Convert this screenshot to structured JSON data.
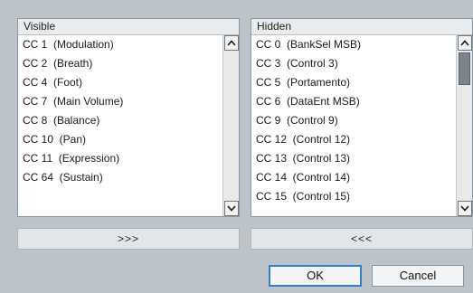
{
  "visible_panel": {
    "header": "Visible",
    "items": [
      "CC 1  (Modulation)",
      "CC 2  (Breath)",
      "CC 4  (Foot)",
      "CC 7  (Main Volume)",
      "CC 8  (Balance)",
      "CC 10  (Pan)",
      "CC 11  (Expression)",
      "CC 64  (Sustain)"
    ]
  },
  "hidden_panel": {
    "header": "Hidden",
    "items": [
      "CC 0  (BankSel MSB)",
      "CC 3  (Control 3)",
      "CC 5  (Portamento)",
      "CC 6  (DataEnt MSB)",
      "CC 9  (Control 9)",
      "CC 12  (Control 12)",
      "CC 13  (Control 13)",
      "CC 14  (Control 14)",
      "CC 15  (Control 15)"
    ]
  },
  "buttons": {
    "show": ">>>",
    "hide": "<<<",
    "ok": "OK",
    "cancel": "Cancel"
  },
  "icons": {
    "scroll_up": "chevron-up-icon",
    "scroll_down": "chevron-down-icon"
  }
}
